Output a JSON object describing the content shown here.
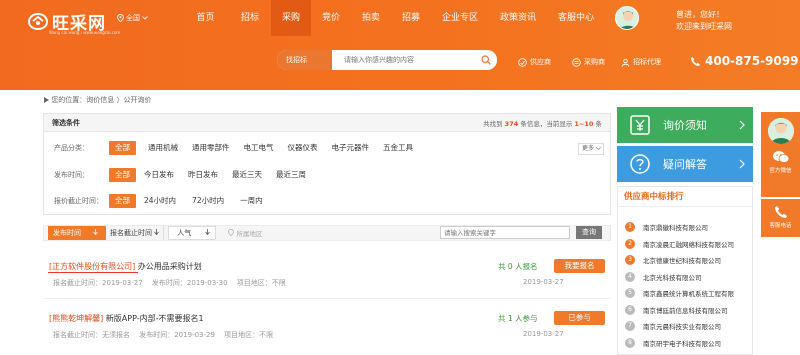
{
  "header": {
    "logo_text": "旺采网",
    "logo_sub": "Wang cai wang / www.wangcai.com",
    "city": "全国",
    "nav": [
      "首页",
      "招标",
      "采购",
      "竞价",
      "拍卖",
      "招募",
      "企业专区",
      "政策资讯",
      "客服中心"
    ],
    "active_nav": "采购",
    "greeting_line1": "曾进，您好！",
    "greeting_line2": "欢迎来到旺采网"
  },
  "search": {
    "category": "找招标",
    "placeholder": "请输入你感兴趣的内容"
  },
  "quick_links": [
    "供应商",
    "采购商",
    "招标代理"
  ],
  "phone": "400-875-9099",
  "breadcrumb": "您的位置：询价信息 〉公开询价",
  "filter": {
    "title": "筛选条件",
    "count_prefix": "共找到",
    "count": "374",
    "count_mid": "条信息，当前显示",
    "range": "1~10",
    "count_suffix": "条",
    "more": "更多",
    "rows": [
      {
        "label": "产品分类：",
        "options": [
          "全部",
          "通用机械",
          "通用零部件",
          "电工电气",
          "仪器仪表",
          "电子元器件",
          "五金工具"
        ]
      },
      {
        "label": "发布时间：",
        "options": [
          "全部",
          "今日发布",
          "昨日发布",
          "最近三天",
          "最近三周"
        ]
      },
      {
        "label": "报价截止时间：",
        "options": [
          "全部",
          "24小时内",
          "72小时内",
          "一周内"
        ]
      }
    ]
  },
  "sortbar": {
    "publish_time": "发布时间",
    "deadline": "报名截止时间",
    "popularity": "人气",
    "region": "所属地区",
    "keyword_placeholder": "请输入搜索关键字",
    "query": "查询"
  },
  "listings": [
    {
      "company": "[正方软件股份有限公司]",
      "title": "办公用品采购计划",
      "meta": "报名截止时间：2019-03-27　 发布时间：2019-03-30　 项目地区：不限",
      "count": "共 0 人报名",
      "date": "2019-03-27",
      "action": "我要报名"
    },
    {
      "company": "[熊熊乾坤解馨]",
      "title": "新版APP-内部-不需要报名1",
      "meta": "报名截止时间：无须报名　 发布时间：2019-03-29　 项目地区：不限",
      "count": "共 1 人参与",
      "date": "2019-03-27",
      "action": "已参与"
    }
  ],
  "sidebar": {
    "notice": "询价须知",
    "faq": "疑问解答",
    "rank_title": "供应商中标排行",
    "rank": [
      {
        "n": "1",
        "name": "南京鼎徽科技有限公司"
      },
      {
        "n": "2",
        "name": "南京凌晨汇融网络科技有限公司"
      },
      {
        "n": "3",
        "name": "北京德康世纪科技有限公司"
      },
      {
        "n": "4",
        "name": "北京光科技有限公司"
      },
      {
        "n": "5",
        "name": "南京鑫晨统计算机系统工程有限"
      },
      {
        "n": "6",
        "name": "南京博廷前信息科技有限公司"
      },
      {
        "n": "7",
        "name": "南京元晨科技实业有限公司"
      },
      {
        "n": "8",
        "name": "南京研宇电子科技有限公司"
      }
    ],
    "rank_colors": [
      "#f07a2a",
      "#f07a2a",
      "#f07a2a",
      "#bbbbbb",
      "#bbbbbb",
      "#bbbbbb",
      "#bbbbbb",
      "#bbbbbb"
    ]
  },
  "floating": {
    "wechat": "官方微信",
    "phone": "客服电话"
  },
  "colors": {
    "brand": "#f26a1f",
    "accent_green": "#3dac5c",
    "accent_blue": "#3d9be0"
  }
}
